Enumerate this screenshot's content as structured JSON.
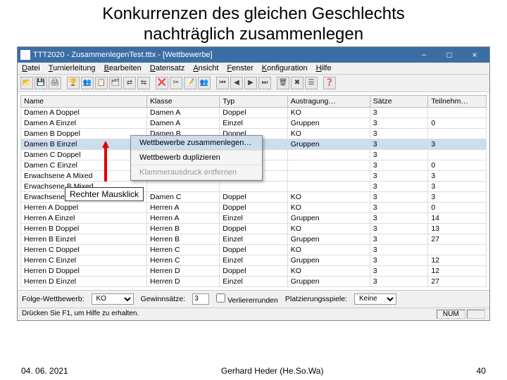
{
  "slide": {
    "title_l1": "Konkurrenzen des gleichen Geschlechts",
    "title_l2": "nachträglich zusammenlegen"
  },
  "window": {
    "title": "TTT2020 - ZusammenlegenTest.tttx - [Wettbewerbe]",
    "min": "−",
    "max": "□",
    "close": "×"
  },
  "menubar": [
    "Datei",
    "Turnierleitung",
    "Bearbeiten",
    "Datensatz",
    "Ansicht",
    "Fenster",
    "Konfiguration",
    "Hilfe"
  ],
  "toolbar_icons": [
    "📂",
    "💾",
    "🖨",
    "│",
    "🏆",
    "👥",
    "📋",
    "🗂",
    "⇄",
    "⇆",
    "│",
    "❌",
    "✂",
    "📝",
    "👥",
    "│",
    "⏮",
    "◀",
    "▶",
    "⏭",
    "│",
    "🗑",
    "✖",
    "☰",
    "│",
    "❓"
  ],
  "columns": [
    "Name",
    "Klasse",
    "Typ",
    "Austragung…",
    "Sätze",
    "Teilnehm…"
  ],
  "rows": [
    {
      "sel": 0,
      "c": [
        "Damen A Doppel",
        "Damen A",
        "Doppel",
        "KO",
        "3",
        ""
      ]
    },
    {
      "sel": 0,
      "c": [
        "Damen A Einzel",
        "Damen A",
        "Einzel",
        "Gruppen",
        "3",
        "0"
      ]
    },
    {
      "sel": 0,
      "c": [
        "Damen B Doppel",
        "Damen B",
        "Doppel",
        "KO",
        "3",
        ""
      ]
    },
    {
      "sel": 1,
      "c": [
        "Damen B Einzel",
        "Damen B",
        "Einzel",
        "Gruppen",
        "3",
        "3"
      ]
    },
    {
      "sel": 0,
      "c": [
        "Damen C Doppel",
        "",
        "",
        "",
        "3",
        ""
      ]
    },
    {
      "sel": 0,
      "c": [
        "Damen C Einzel",
        "",
        "",
        "",
        "3",
        "0"
      ]
    },
    {
      "sel": 0,
      "c": [
        "Erwachsene A Mixed",
        "",
        "",
        "",
        "3",
        "3"
      ]
    },
    {
      "sel": 0,
      "c": [
        "Erwachsene B Mixed",
        "",
        "",
        "",
        "3",
        "3"
      ]
    },
    {
      "sel": 0,
      "c": [
        "Erwachsene C Mixed",
        "Damen C",
        "Doppel",
        "KO",
        "3",
        "3"
      ]
    },
    {
      "sel": 0,
      "c": [
        "Herren A Doppel",
        "Herren A",
        "Doppel",
        "KO",
        "3",
        "0"
      ]
    },
    {
      "sel": 0,
      "c": [
        "Herren A Einzel",
        "Herren A",
        "Einzel",
        "Gruppen",
        "3",
        "14"
      ]
    },
    {
      "sel": 0,
      "c": [
        "Herren B Doppel",
        "Herren B",
        "Doppel",
        "KO",
        "3",
        "13"
      ]
    },
    {
      "sel": 0,
      "c": [
        "Herren B Einzel",
        "Herren B",
        "Einzel",
        "Gruppen",
        "3",
        "27"
      ]
    },
    {
      "sel": 0,
      "c": [
        "Herren C Doppel",
        "Herren C",
        "Doppel",
        "KO",
        "3",
        ""
      ]
    },
    {
      "sel": 0,
      "c": [
        "Herren C Einzel",
        "Herren C",
        "Einzel",
        "Gruppen",
        "3",
        "12"
      ]
    },
    {
      "sel": 0,
      "c": [
        "Herren D Doppel",
        "Herren D",
        "Doppel",
        "KO",
        "3",
        "12"
      ]
    },
    {
      "sel": 0,
      "c": [
        "Herren D Einzel",
        "Herren D",
        "Einzel",
        "Gruppen",
        "3",
        "27"
      ]
    }
  ],
  "context_menu": {
    "i1": "Wettbewerbe zusammenlegen…",
    "i2": "Wettbewerb duplizieren",
    "i3": "Klammerausdruck entfernen"
  },
  "bottom": {
    "folge_label": "Folge-Wettbewerb:",
    "folge_value": "KO",
    "gewinn_label": "Gewinnsätze:",
    "gewinn_value": "3",
    "verlierer_label": "Verliererrunden",
    "platz_label": "Platzierungsspiele:",
    "platz_value": "Keine"
  },
  "statusbar": {
    "help": "Drücken Sie F1, um Hilfe zu erhalten.",
    "num": "NUM"
  },
  "callout": "Rechter Mausklick",
  "footer": {
    "date": "04. 06. 2021",
    "author": "Gerhard Heder (He.So.Wa)",
    "page": "40"
  }
}
